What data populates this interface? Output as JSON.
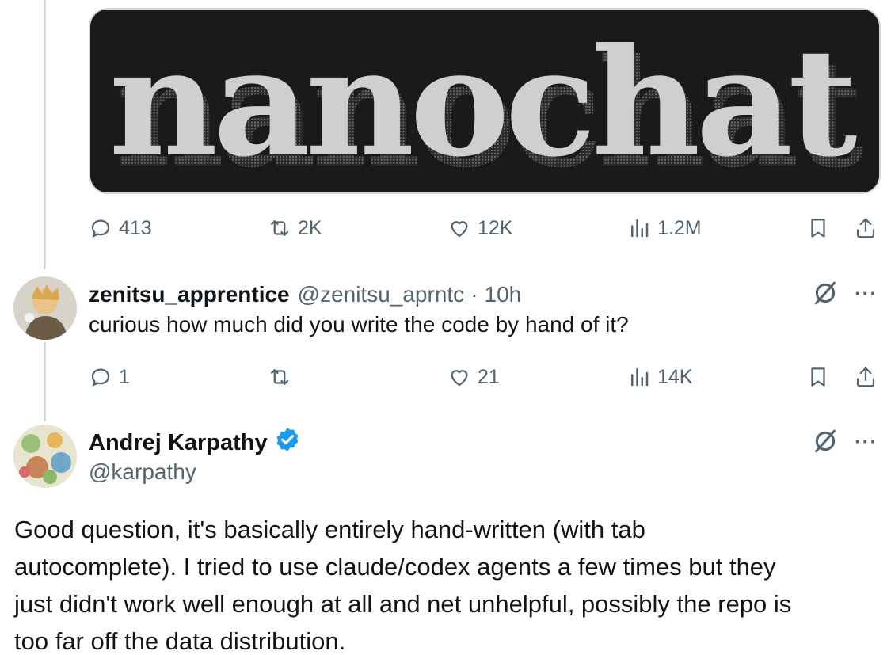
{
  "media": {
    "title": "nanochat"
  },
  "tweet_stats": {
    "replies": "413",
    "reposts": "2K",
    "likes": "12K",
    "views": "1.2M"
  },
  "reply": {
    "display_name": "zenitsu_apprentice",
    "handle": "@zenitsu_aprntc",
    "separator": "·",
    "time": "10h",
    "text": "curious how much did you write the code by hand of it?",
    "stats": {
      "replies": "1",
      "reposts": "",
      "likes": "21",
      "views": "14K"
    }
  },
  "author": {
    "display_name": "Andrej Karpathy",
    "handle": "@karpathy",
    "verified": true,
    "body_lines": [
      "Good question, it's basically entirely hand-written (with tab",
      "autocomplete). I tried to use claude/codex agents a few times but they",
      "just didn't work well enough at all and net unhelpful, possibly the repo is",
      "too far off the data distribution."
    ]
  },
  "colors": {
    "muted": "#536471",
    "text": "#0f1419",
    "verified": "#1d9bf0",
    "thread_line": "#cfd9de"
  },
  "icons": [
    "reply-icon",
    "repost-icon",
    "like-icon",
    "views-icon",
    "bookmark-icon",
    "share-icon",
    "grok-icon",
    "more-icon",
    "verified-badge-icon"
  ],
  "more_label": "···"
}
